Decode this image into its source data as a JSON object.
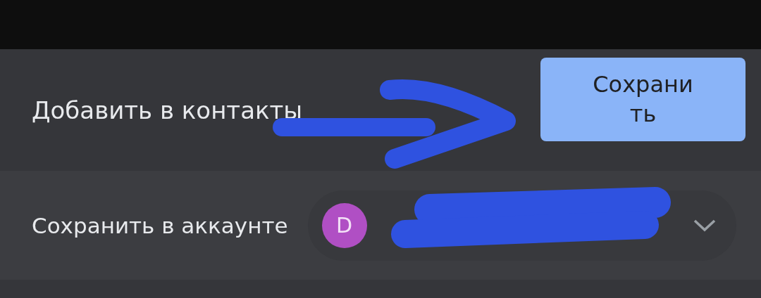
{
  "dialog": {
    "title": "Добавить в контакты",
    "save_button": "Сохранить"
  },
  "account_row": {
    "label": "Сохранить в аккаунте",
    "avatar_letter": "D",
    "expanded": false
  }
}
